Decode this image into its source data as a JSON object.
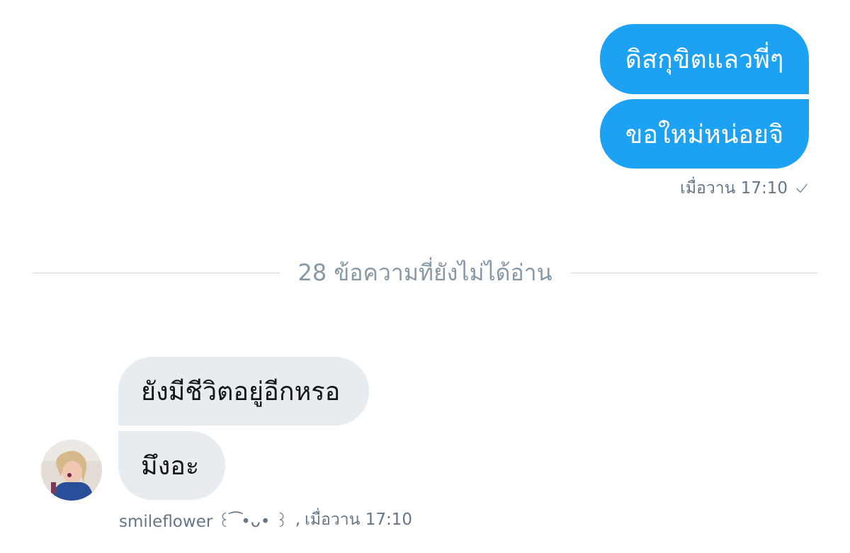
{
  "conversation": {
    "outgoing": {
      "messages": [
        {
          "text": "ดิสกุขิตแลวพี่ๆ"
        },
        {
          "text": "ขอใหม่หน่อยจิ"
        }
      ],
      "timestamp": "เมื่อวาน 17:10",
      "status_icon": "check-icon"
    },
    "unread_divider": {
      "label": "28 ข้อความที่ยังไม่ได้อ่าน"
    },
    "incoming": {
      "messages": [
        {
          "text": "ยังมีชีวิตอยู่อีกหรอ"
        },
        {
          "text": "มึงอะ"
        }
      ],
      "sender": "smileflower ꒰ ͡ •ᴗ• ꒱",
      "timestamp": "เมื่อวาน 17:10",
      "avatar_icon": "user-avatar"
    }
  },
  "colors": {
    "outgoing_bubble": "#1da1f2",
    "incoming_bubble": "#e6ecf0",
    "meta_text": "#657786",
    "divider_line": "#ccd6dd",
    "divider_text": "#8899a6"
  }
}
